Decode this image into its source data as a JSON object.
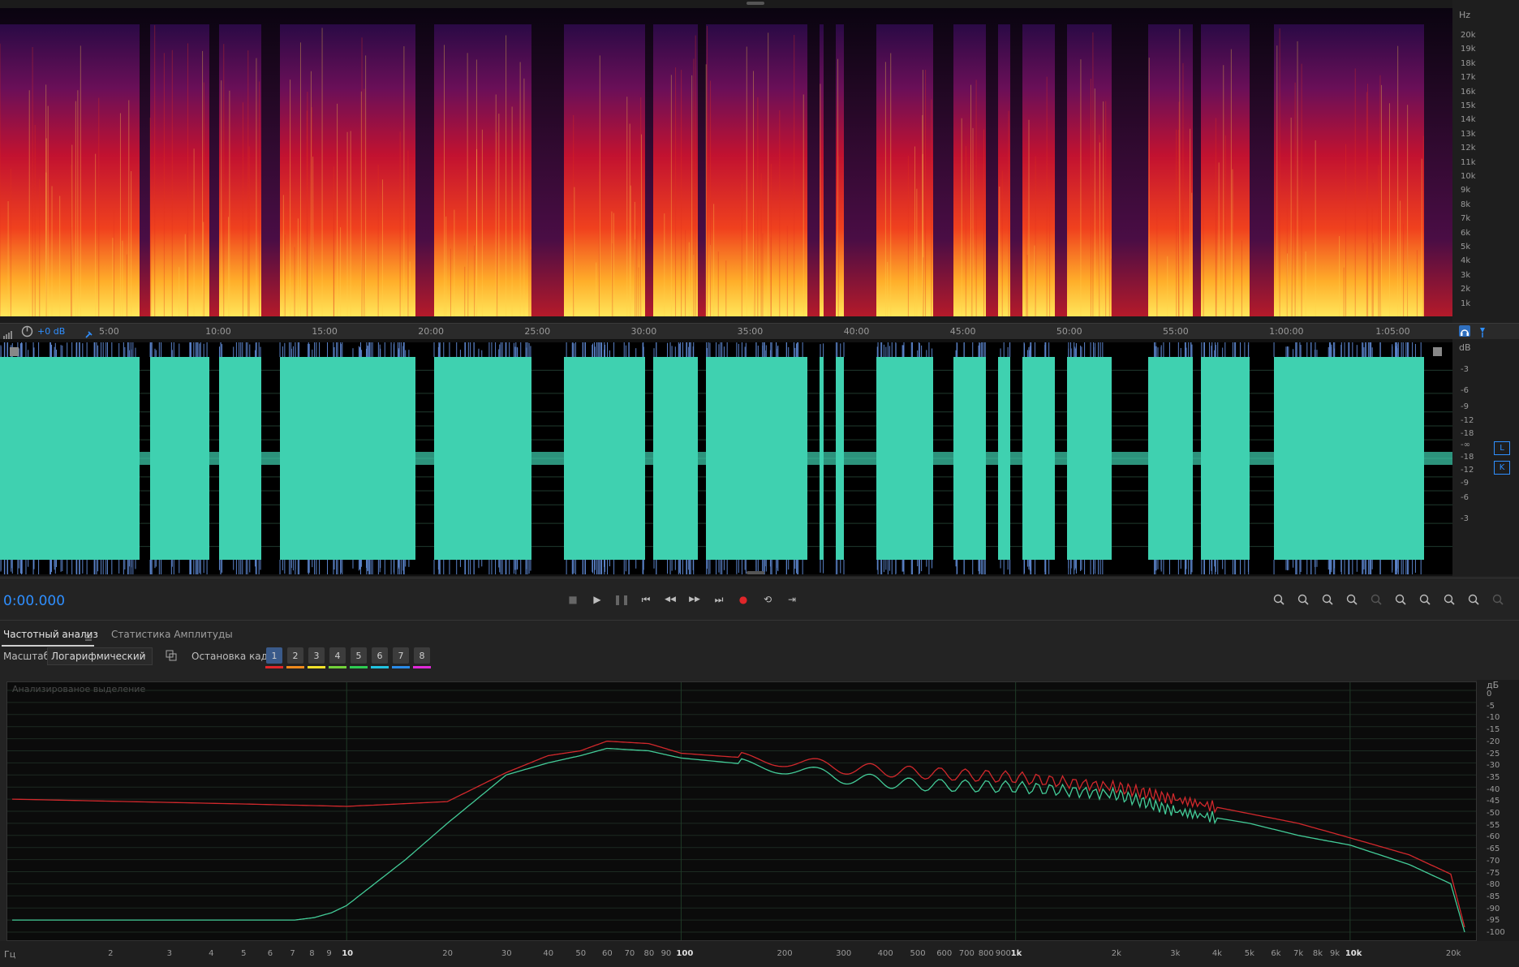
{
  "spectral": {
    "unit_label": "Hz",
    "freq_labels": [
      "20k",
      "19k",
      "18k",
      "17k",
      "16k",
      "15k",
      "14k",
      "13k",
      "12k",
      "11k",
      "10k",
      "9k",
      "8k",
      "7k",
      "6k",
      "5k",
      "4k",
      "3k",
      "2k",
      "1k"
    ]
  },
  "timeline": {
    "gain_label": "+0 dB",
    "labels": [
      "5:00",
      "10:00",
      "15:00",
      "20:00",
      "25:00",
      "30:00",
      "35:00",
      "40:00",
      "45:00",
      "50:00",
      "55:00",
      "1:00:00",
      "1:05:00"
    ]
  },
  "waveform": {
    "unit_label": "dB",
    "db_labels": [
      "-3",
      "-6",
      "-9",
      "-12",
      "-18",
      "-∞",
      "-18",
      "-12",
      "-9",
      "-6",
      "-3"
    ],
    "channel_l": "L",
    "channel_r": "K",
    "color": "#3fd1b0"
  },
  "transport": {
    "time": "0:00.000",
    "buttons": [
      "stop-icon",
      "play-icon",
      "pause-icon",
      "go-to-start-icon",
      "rewind-icon",
      "fast-forward-icon",
      "go-to-end-icon",
      "record-icon",
      "loop-icon",
      "skip-selection-icon"
    ],
    "zoom_buttons": [
      "zoom-in-amplitude-icon",
      "zoom-out-amplitude-icon",
      "zoom-reset-icon",
      "zoom-selection-icon",
      "zoom-out-full-icon",
      "zoom-in-left-icon",
      "zoom-in-right-icon",
      "zoom-out-both-icon",
      "zoom-history-icon",
      "zoom-disabled-icon"
    ]
  },
  "panel": {
    "tab_frequency": "Частотный анализ",
    "tab_amplitude": "Статистика Амплитуды"
  },
  "options": {
    "scale_label": "Масштаб:",
    "scale_value": "Логарифмический",
    "freeze_label": "Остановка кадра:",
    "frames": [
      "1",
      "2",
      "3",
      "4",
      "5",
      "6",
      "7",
      "8"
    ],
    "frame_colors": [
      "#e0262a",
      "#f08a1c",
      "#f2e22a",
      "#72d23a",
      "#2ecc52",
      "#21c3e0",
      "#2a8be8",
      "#e02ad8"
    ]
  },
  "frequency_plot": {
    "caption": "Анализированое выделение",
    "db_unit": "дБ",
    "db_labels": [
      "0",
      "-5",
      "-10",
      "-15",
      "-20",
      "-25",
      "-30",
      "-35",
      "-40",
      "-45",
      "-50",
      "-55",
      "-60",
      "-65",
      "-70",
      "-75",
      "-80",
      "-85",
      "-90",
      "-95",
      "-100"
    ],
    "hz_unit": "Гц",
    "hz_labels": [
      "2",
      "3",
      "4",
      "5",
      "6",
      "7",
      "8",
      "9",
      "10",
      "20",
      "30",
      "40",
      "50",
      "60",
      "70",
      "80",
      "90",
      "100",
      "200",
      "300",
      "400",
      "500",
      "600",
      "700",
      "800",
      "900",
      "1k",
      "2k",
      "3k",
      "4k",
      "5k",
      "6k",
      "7k",
      "8k",
      "9k",
      "10k",
      "20k"
    ],
    "series_colors": {
      "red": "#d2282c",
      "green": "#43cc98"
    }
  },
  "chart_data": {
    "type": "line",
    "x_scale": "log",
    "xlim": [
      1,
      22000
    ],
    "ylim": [
      -100,
      0
    ],
    "ylabel": "дБ",
    "xlabel": "Гц",
    "series": [
      {
        "color": "#d2282c",
        "x": [
          1,
          5,
          10,
          20,
          30,
          40,
          50,
          60,
          80,
          100,
          200,
          300,
          500,
          1000,
          2000,
          3000,
          5000,
          7000,
          10000,
          15000,
          20000,
          22000
        ],
        "y": [
          -45,
          -47,
          -48,
          -46,
          -34,
          -27,
          -25,
          -21,
          -22,
          -26,
          -29,
          -32,
          -34,
          -36,
          -40,
          -45,
          -51,
          -55,
          -61,
          -68,
          -76,
          -98
        ]
      },
      {
        "color": "#43cc98",
        "x": [
          1,
          5,
          7,
          8,
          9,
          10,
          15,
          20,
          30,
          40,
          50,
          60,
          80,
          100,
          200,
          300,
          500,
          1000,
          2000,
          3000,
          5000,
          7000,
          10000,
          15000,
          20000,
          22000
        ],
        "y": [
          -95,
          -95,
          -95,
          -94,
          -92,
          -89,
          -70,
          -55,
          -35,
          -30,
          -27,
          -24,
          -25,
          -28,
          -32,
          -36,
          -39,
          -40,
          -43,
          -50,
          -55,
          -60,
          -64,
          -72,
          -80,
          -100
        ]
      }
    ]
  }
}
